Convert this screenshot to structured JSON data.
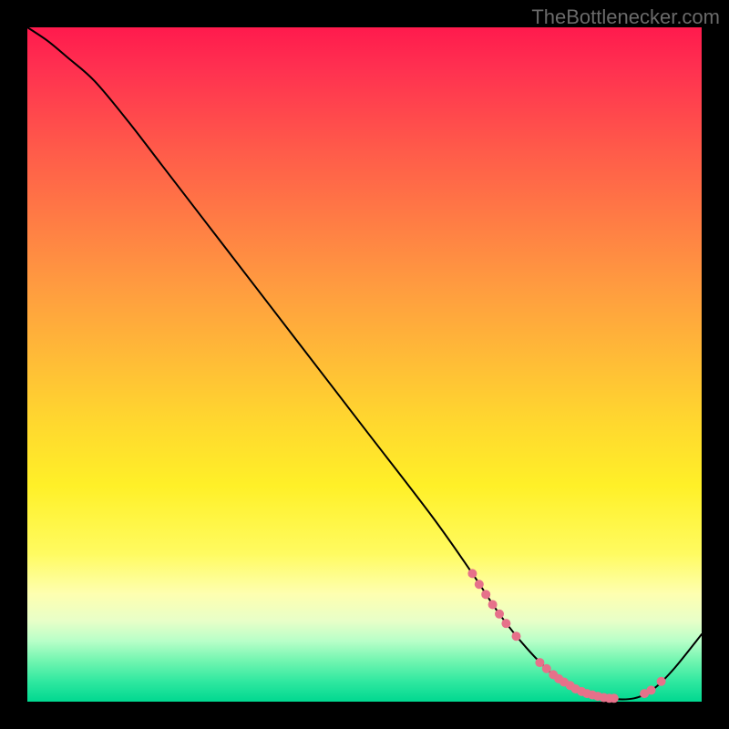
{
  "watermark": "TheBottlenecker.com",
  "chart_data": {
    "type": "line",
    "title": "",
    "xlabel": "",
    "ylabel": "",
    "xlim": [
      0,
      100
    ],
    "ylim": [
      0,
      100
    ],
    "grid": false,
    "legend": false,
    "series": [
      {
        "name": "curve",
        "color": "#000000",
        "x": [
          0,
          3,
          6,
          10,
          15,
          20,
          30,
          40,
          50,
          60,
          66,
          70,
          74,
          78,
          82,
          86,
          90,
          93,
          96,
          100
        ],
        "y": [
          100,
          98,
          95.5,
          92,
          86,
          79.5,
          66.5,
          53.5,
          40.5,
          27.5,
          19,
          13,
          8,
          4,
          1.5,
          0.5,
          0.5,
          2,
          5,
          10
        ]
      }
    ],
    "highlight_points": {
      "color": "#e6718a",
      "radius_px": 5,
      "points": [
        {
          "x": 66.0,
          "y": 19.0
        },
        {
          "x": 67.0,
          "y": 17.4
        },
        {
          "x": 68.0,
          "y": 15.9
        },
        {
          "x": 69.0,
          "y": 14.4
        },
        {
          "x": 70.0,
          "y": 13.0
        },
        {
          "x": 71.0,
          "y": 11.6
        },
        {
          "x": 72.5,
          "y": 9.7
        },
        {
          "x": 76.0,
          "y": 5.8
        },
        {
          "x": 77.0,
          "y": 4.9
        },
        {
          "x": 78.0,
          "y": 4.0
        },
        {
          "x": 78.8,
          "y": 3.4
        },
        {
          "x": 79.6,
          "y": 2.9
        },
        {
          "x": 80.5,
          "y": 2.4
        },
        {
          "x": 81.3,
          "y": 1.9
        },
        {
          "x": 82.2,
          "y": 1.5
        },
        {
          "x": 83.0,
          "y": 1.2
        },
        {
          "x": 83.8,
          "y": 1.0
        },
        {
          "x": 84.6,
          "y": 0.8
        },
        {
          "x": 85.5,
          "y": 0.6
        },
        {
          "x": 86.3,
          "y": 0.5
        },
        {
          "x": 87.0,
          "y": 0.5
        },
        {
          "x": 91.5,
          "y": 1.2
        },
        {
          "x": 92.5,
          "y": 1.7
        },
        {
          "x": 94.0,
          "y": 3.0
        }
      ]
    },
    "gradient_stops": [
      {
        "pct": 0,
        "color": "#ff1a4d"
      },
      {
        "pct": 6,
        "color": "#ff3050"
      },
      {
        "pct": 18,
        "color": "#ff5a4a"
      },
      {
        "pct": 28,
        "color": "#ff7a45"
      },
      {
        "pct": 38,
        "color": "#ff9a40"
      },
      {
        "pct": 48,
        "color": "#ffb838"
      },
      {
        "pct": 58,
        "color": "#ffd62f"
      },
      {
        "pct": 68,
        "color": "#fff028"
      },
      {
        "pct": 78,
        "color": "#fffb60"
      },
      {
        "pct": 84,
        "color": "#feffb0"
      },
      {
        "pct": 88,
        "color": "#e8ffc8"
      },
      {
        "pct": 91,
        "color": "#b8ffc8"
      },
      {
        "pct": 94,
        "color": "#70f5b0"
      },
      {
        "pct": 97,
        "color": "#30e8a0"
      },
      {
        "pct": 100,
        "color": "#00d890"
      }
    ]
  }
}
